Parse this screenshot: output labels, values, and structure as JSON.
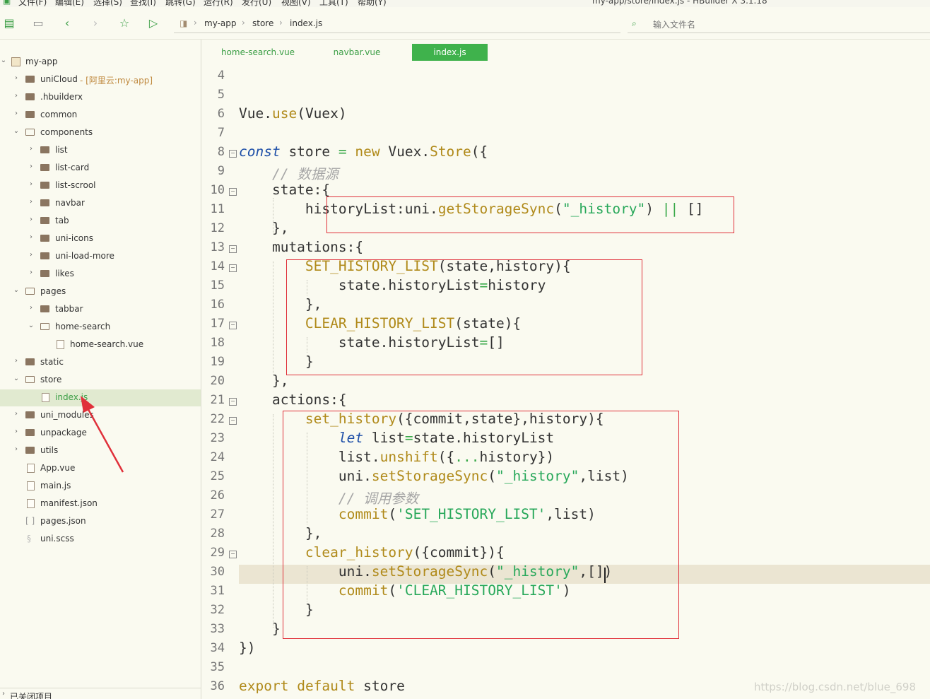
{
  "window": {
    "menus": [
      "文件(F)",
      "编辑(E)",
      "选择(S)",
      "查找(I)",
      "跳转(G)",
      "运行(R)",
      "发行(U)",
      "视图(V)",
      "工具(T)",
      "帮助(Y)"
    ],
    "title": "my-app/store/index.js - HBuilder X 3.1.18"
  },
  "toolbar": {
    "breadcrumb": [
      "my-app",
      "store",
      "index.js"
    ],
    "file_search_placeholder": "输入文件名"
  },
  "sidebar": {
    "root": "my-app",
    "items": [
      {
        "label": "uniCloud",
        "tag": "- [阿里云:my-app]"
      },
      {
        "label": ".hbuilderx"
      },
      {
        "label": "common"
      },
      {
        "label": "components"
      },
      {
        "label": "list"
      },
      {
        "label": "list-card"
      },
      {
        "label": "list-scrool"
      },
      {
        "label": "navbar"
      },
      {
        "label": "tab"
      },
      {
        "label": "uni-icons"
      },
      {
        "label": "uni-load-more"
      },
      {
        "label": "likes"
      },
      {
        "label": "pages"
      },
      {
        "label": "tabbar"
      },
      {
        "label": "home-search"
      },
      {
        "label": "home-search.vue"
      },
      {
        "label": "static"
      },
      {
        "label": "store"
      },
      {
        "label": "index.js"
      },
      {
        "label": "uni_modules"
      },
      {
        "label": "unpackage"
      },
      {
        "label": "utils"
      },
      {
        "label": "App.vue"
      },
      {
        "label": "main.js"
      },
      {
        "label": "manifest.json"
      },
      {
        "label": "pages.json"
      },
      {
        "label": "uni.scss"
      }
    ],
    "closed_projects": "已关闭项目"
  },
  "tabs": [
    "home-search.vue",
    "navbar.vue",
    "index.js"
  ],
  "editor": {
    "line_numbers": [
      "4",
      "5",
      "6",
      "7",
      "8",
      "9",
      "10",
      "11",
      "12",
      "13",
      "14",
      "15",
      "16",
      "17",
      "18",
      "19",
      "20",
      "21",
      "22",
      "23",
      "24",
      "25",
      "26",
      "27",
      "28",
      "29",
      "30",
      "31",
      "32",
      "33",
      "34",
      "35",
      "36"
    ],
    "lines": [
      {
        "t": [
          {
            "s": "",
            "c": ""
          }
        ]
      },
      {
        "t": [
          {
            "s": "",
            "c": ""
          }
        ]
      },
      {
        "t": [
          {
            "s": "Vue.",
            "c": ""
          },
          {
            "s": "use",
            "c": "fn"
          },
          {
            "s": "(Vuex)",
            "c": ""
          }
        ]
      },
      {
        "t": [
          {
            "s": "",
            "c": ""
          }
        ]
      },
      {
        "t": [
          {
            "s": "const",
            "c": "kw"
          },
          {
            "s": " store ",
            "c": ""
          },
          {
            "s": "=",
            "c": "op"
          },
          {
            "s": " ",
            "c": ""
          },
          {
            "s": "new",
            "c": "fn"
          },
          {
            "s": " Vuex.",
            "c": ""
          },
          {
            "s": "Store",
            "c": "fn"
          },
          {
            "s": "({",
            "c": ""
          }
        ]
      },
      {
        "t": [
          {
            "s": "    ",
            "c": ""
          },
          {
            "s": "// 数据源",
            "c": "cm"
          }
        ]
      },
      {
        "t": [
          {
            "s": "    state:{",
            "c": ""
          }
        ]
      },
      {
        "t": [
          {
            "s": "        historyList:uni.",
            "c": ""
          },
          {
            "s": "getStorageSync",
            "c": "fn"
          },
          {
            "s": "(",
            "c": ""
          },
          {
            "s": "\"_history\"",
            "c": "str"
          },
          {
            "s": ") ",
            "c": ""
          },
          {
            "s": "||",
            "c": "op"
          },
          {
            "s": " []",
            "c": ""
          }
        ]
      },
      {
        "t": [
          {
            "s": "    },",
            "c": ""
          }
        ]
      },
      {
        "t": [
          {
            "s": "    mutations:{",
            "c": ""
          }
        ]
      },
      {
        "t": [
          {
            "s": "        ",
            "c": ""
          },
          {
            "s": "SET_HISTORY_LIST",
            "c": "fn"
          },
          {
            "s": "(state,history){",
            "c": ""
          }
        ]
      },
      {
        "t": [
          {
            "s": "            state.historyList",
            "c": ""
          },
          {
            "s": "=",
            "c": "op"
          },
          {
            "s": "history",
            "c": ""
          }
        ]
      },
      {
        "t": [
          {
            "s": "        },",
            "c": ""
          }
        ]
      },
      {
        "t": [
          {
            "s": "        ",
            "c": ""
          },
          {
            "s": "CLEAR_HISTORY_LIST",
            "c": "fn"
          },
          {
            "s": "(state){",
            "c": ""
          }
        ]
      },
      {
        "t": [
          {
            "s": "            state.historyList",
            "c": ""
          },
          {
            "s": "=",
            "c": "op"
          },
          {
            "s": "[]",
            "c": ""
          }
        ]
      },
      {
        "t": [
          {
            "s": "        }",
            "c": ""
          }
        ]
      },
      {
        "t": [
          {
            "s": "    },",
            "c": ""
          }
        ]
      },
      {
        "t": [
          {
            "s": "    actions:{",
            "c": ""
          }
        ]
      },
      {
        "t": [
          {
            "s": "        ",
            "c": ""
          },
          {
            "s": "set_history",
            "c": "fn"
          },
          {
            "s": "({commit,state},history){",
            "c": ""
          }
        ]
      },
      {
        "t": [
          {
            "s": "            ",
            "c": ""
          },
          {
            "s": "let",
            "c": "kw"
          },
          {
            "s": " list",
            "c": ""
          },
          {
            "s": "=",
            "c": "op"
          },
          {
            "s": "state.historyList",
            "c": ""
          }
        ]
      },
      {
        "t": [
          {
            "s": "            list.",
            "c": ""
          },
          {
            "s": "unshift",
            "c": "fn"
          },
          {
            "s": "({",
            "c": ""
          },
          {
            "s": "...",
            "c": "op"
          },
          {
            "s": "history})",
            "c": ""
          }
        ]
      },
      {
        "t": [
          {
            "s": "            uni.",
            "c": ""
          },
          {
            "s": "setStorageSync",
            "c": "fn"
          },
          {
            "s": "(",
            "c": ""
          },
          {
            "s": "\"_history\"",
            "c": "str"
          },
          {
            "s": ",list)",
            "c": ""
          }
        ]
      },
      {
        "t": [
          {
            "s": "            ",
            "c": ""
          },
          {
            "s": "// 调用参数",
            "c": "cm"
          }
        ]
      },
      {
        "t": [
          {
            "s": "            ",
            "c": ""
          },
          {
            "s": "commit",
            "c": "fn"
          },
          {
            "s": "(",
            "c": ""
          },
          {
            "s": "'SET_HISTORY_LIST'",
            "c": "str"
          },
          {
            "s": ",list)",
            "c": ""
          }
        ]
      },
      {
        "t": [
          {
            "s": "        },",
            "c": ""
          }
        ]
      },
      {
        "t": [
          {
            "s": "        ",
            "c": ""
          },
          {
            "s": "clear_history",
            "c": "fn"
          },
          {
            "s": "({commit}){",
            "c": ""
          }
        ]
      },
      {
        "t": [
          {
            "s": "            uni.",
            "c": ""
          },
          {
            "s": "setStorageSync",
            "c": "fn"
          },
          {
            "s": "(",
            "c": ""
          },
          {
            "s": "\"_history\"",
            "c": "str"
          },
          {
            "s": ",[])",
            "c": ""
          }
        ]
      },
      {
        "t": [
          {
            "s": "            ",
            "c": ""
          },
          {
            "s": "commit",
            "c": "fn"
          },
          {
            "s": "(",
            "c": ""
          },
          {
            "s": "'CLEAR_HISTORY_LIST'",
            "c": "str"
          },
          {
            "s": ")",
            "c": ""
          }
        ]
      },
      {
        "t": [
          {
            "s": "        }",
            "c": ""
          }
        ]
      },
      {
        "t": [
          {
            "s": "    }",
            "c": ""
          }
        ]
      },
      {
        "t": [
          {
            "s": "})",
            "c": ""
          }
        ]
      },
      {
        "t": [
          {
            "s": "",
            "c": ""
          }
        ]
      },
      {
        "t": [
          {
            "s": "export",
            "c": "fn"
          },
          {
            "s": " ",
            "c": ""
          },
          {
            "s": "default",
            "c": "fn"
          },
          {
            "s": " store",
            "c": ""
          }
        ]
      }
    ]
  },
  "watermark": "https://blog.csdn.net/blue_698",
  "colors": {
    "accent": "#3fb24c",
    "annotation": "#e0303a"
  }
}
